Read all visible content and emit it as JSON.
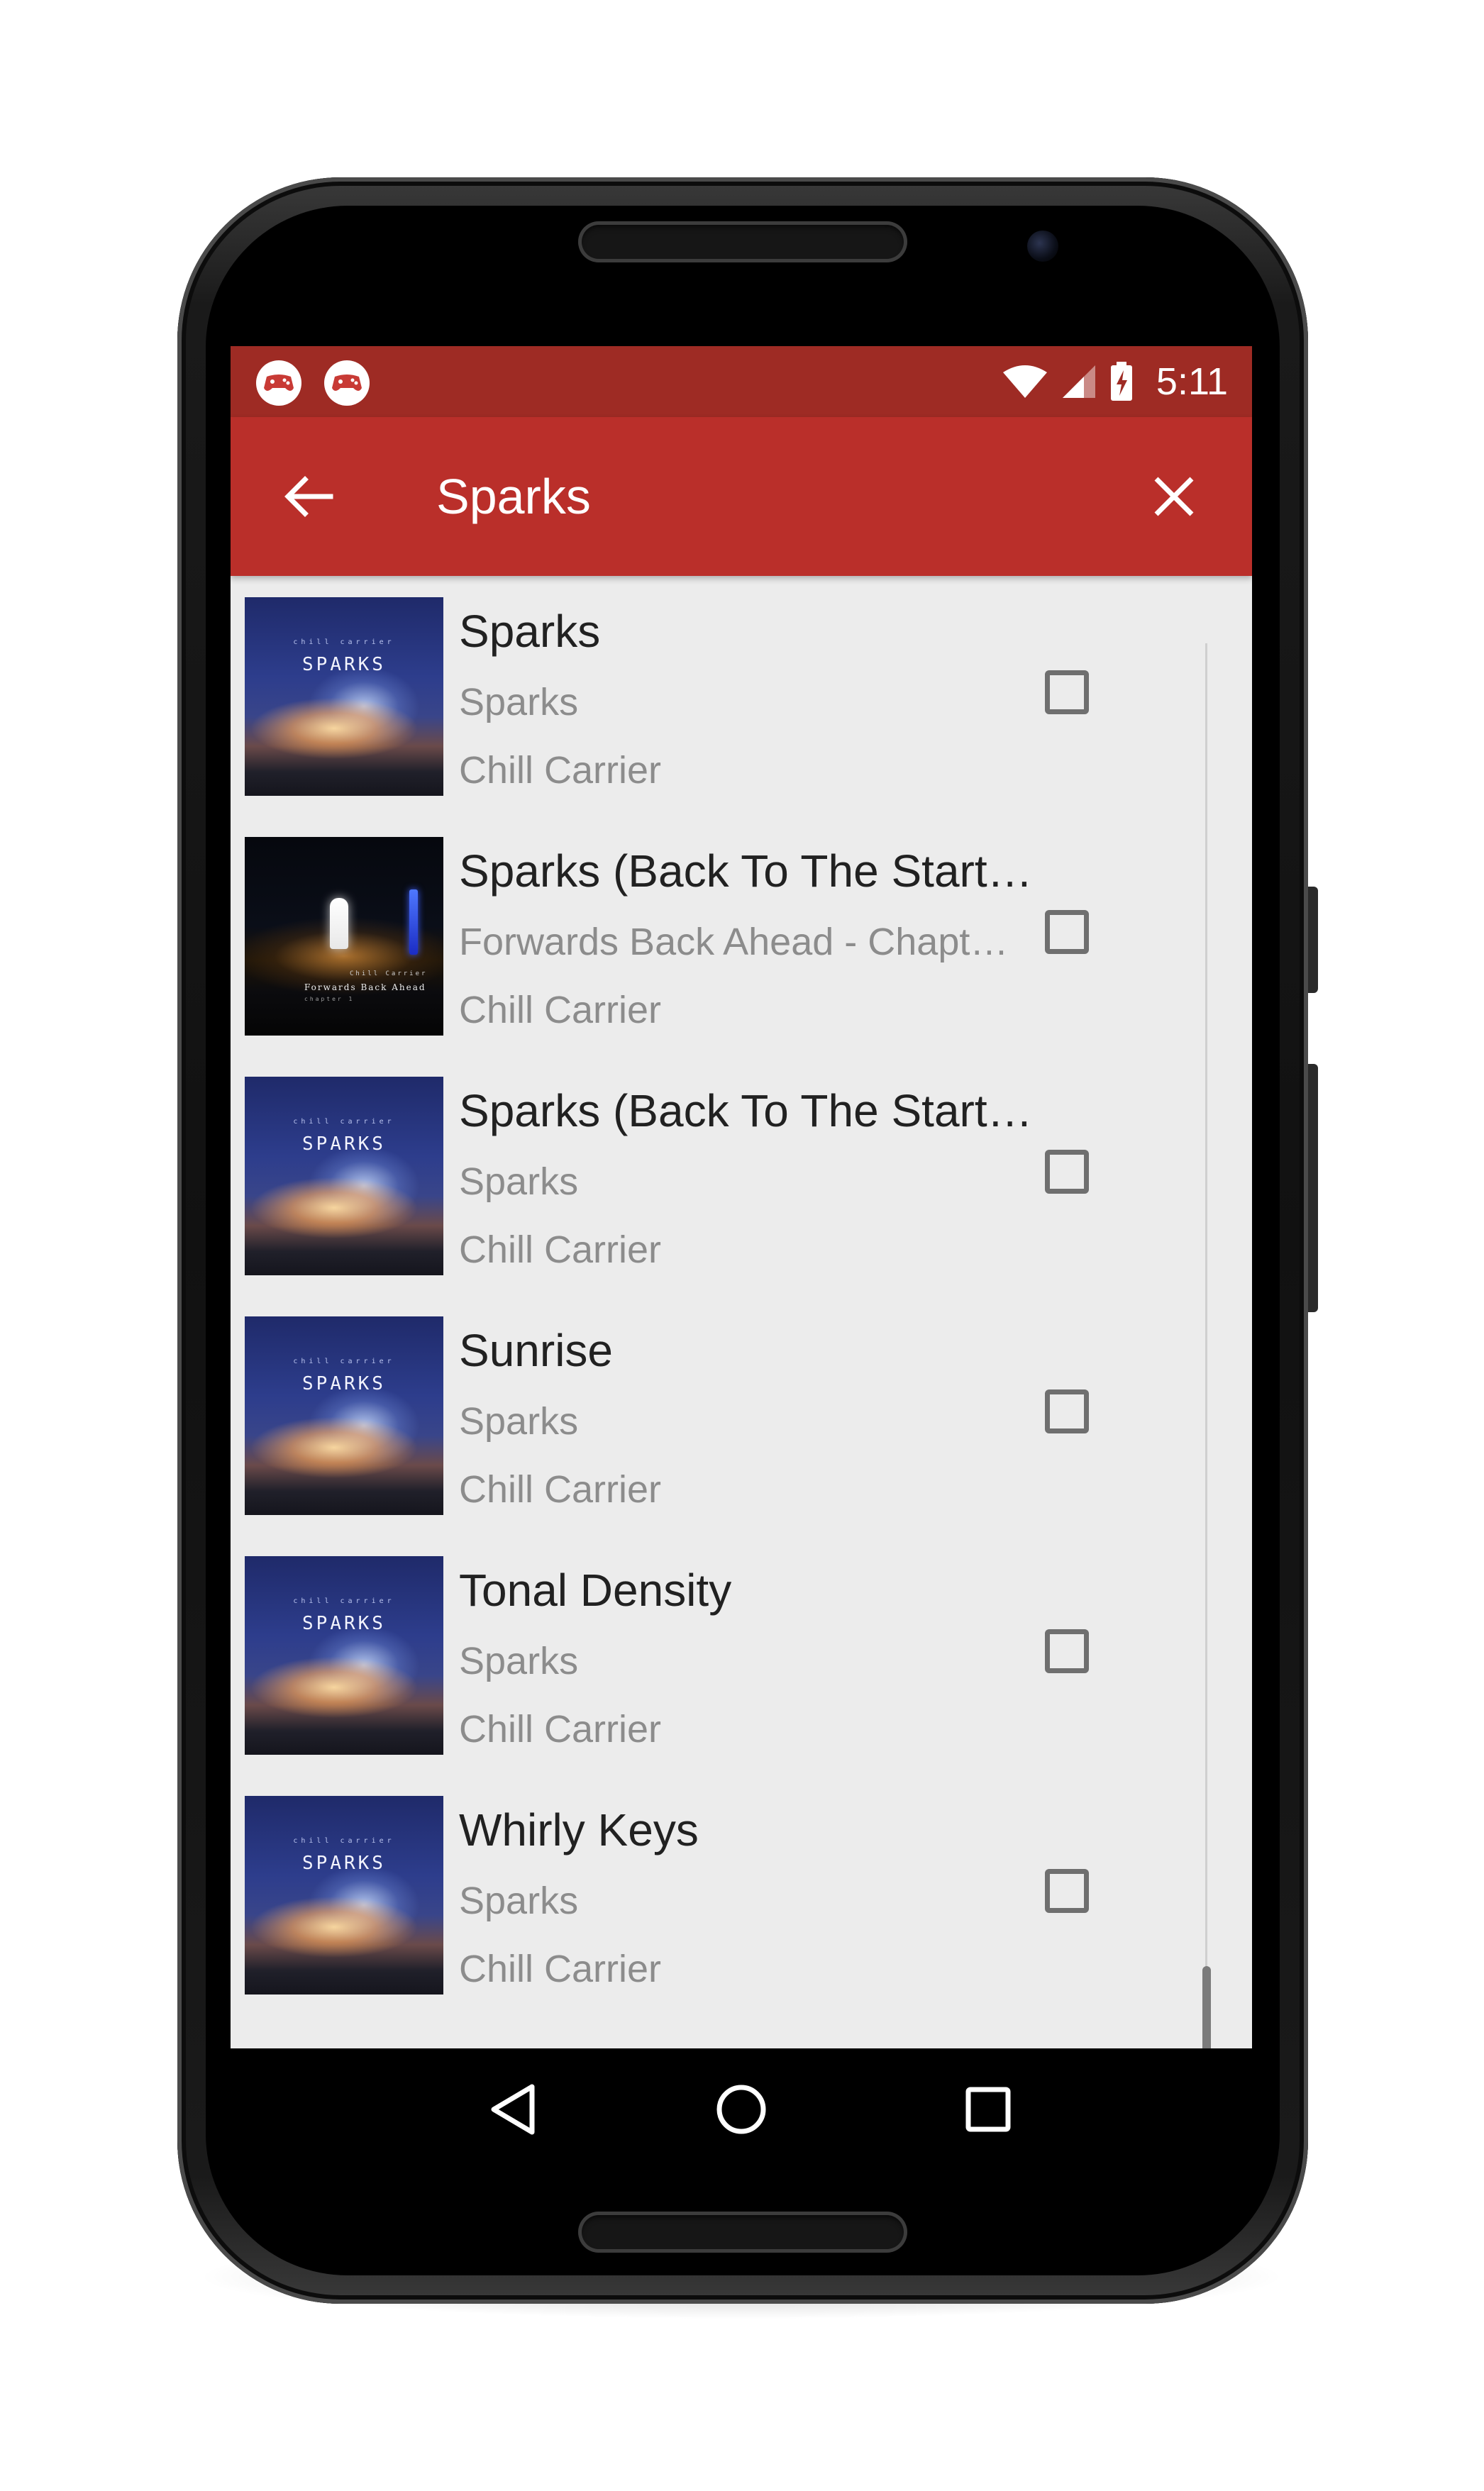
{
  "status_bar": {
    "time": "5:11",
    "notification_icons": [
      "game-controller-icon",
      "game-controller-icon"
    ],
    "icons": [
      "wifi-icon",
      "cell-signal-icon",
      "battery-charging-icon"
    ],
    "color": "#9e2b24"
  },
  "app_bar": {
    "title": "Sparks",
    "back_icon": "arrow-back-icon",
    "close_icon": "close-icon",
    "color": "#ba2f2a"
  },
  "songs": [
    {
      "title": "Sparks",
      "album": "Sparks",
      "artist": "Chill Carrier",
      "checked": false,
      "art": "sparks-album-art"
    },
    {
      "title": "Sparks (Back To The Start…",
      "album": "Forwards Back Ahead - Chapt…",
      "artist": "Chill Carrier",
      "checked": false,
      "art": "forwards-back-ahead-album-art"
    },
    {
      "title": "Sparks (Back To The Start…",
      "album": "Sparks",
      "artist": "Chill Carrier",
      "checked": false,
      "art": "sparks-album-art"
    },
    {
      "title": "Sunrise",
      "album": "Sparks",
      "artist": "Chill Carrier",
      "checked": false,
      "art": "sparks-album-art"
    },
    {
      "title": "Tonal Density",
      "album": "Sparks",
      "artist": "Chill Carrier",
      "checked": false,
      "art": "sparks-album-art"
    },
    {
      "title": "Whirly Keys",
      "album": "Sparks",
      "artist": "Chill Carrier",
      "checked": false,
      "art": "sparks-album-art"
    }
  ],
  "album_art": {
    "sparks": {
      "small_text": "chill carrier",
      "title": "SPARKS"
    },
    "forwards": {
      "small_text": "Chill Carrier",
      "title": "Forwards Back Ahead",
      "subtitle": "chapter 1"
    }
  },
  "nav_bar": {
    "buttons": [
      "back-triangle-icon",
      "home-circle-icon",
      "recents-square-icon"
    ]
  }
}
